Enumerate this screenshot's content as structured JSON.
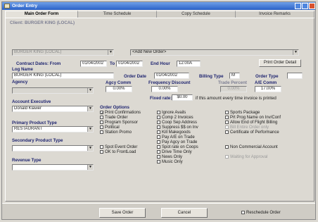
{
  "window": {
    "title": "Order Entry"
  },
  "tabs": [
    "Main Order Form",
    "Time Schedule",
    "Copy Schedule",
    "Invoice Remarks"
  ],
  "client_label": "Client: BURGER KING (LOCAL)",
  "advertiser_value": "BURGER KING (LOCAL)",
  "order_select_value": "<Add New Order>",
  "contract": {
    "label": "Contract Dates: From",
    "from": "01/04/2002",
    "to_label": "To",
    "to": "01/04/2002",
    "end_hour_label": "End Hour",
    "end_hour": "12:00A"
  },
  "print_detail_button": "Print Order Detail",
  "log_name": {
    "label": "Log Name",
    "value": "BURGER KING (LOCAL)"
  },
  "order_date": {
    "label": "Order Date",
    "value": "01/04/2002"
  },
  "billing_type": {
    "label": "Billing Type",
    "value": "M"
  },
  "order_type": {
    "label": "Order Type",
    "value": ""
  },
  "agency": {
    "label": "Agency",
    "value": ""
  },
  "agcy_comm": {
    "label": "Agcy Comm",
    "value": "0.00%"
  },
  "freq_discount": {
    "label": "Frequency Discount",
    "value": "0.00%"
  },
  "trade_percent": {
    "label": "Trade Percent",
    "value": "0.00%"
  },
  "ae_comm": {
    "label": "A/E Comm",
    "value": "17.00%"
  },
  "fixed_rate": {
    "label": "Fixed rate:",
    "value": "$0.00",
    "note": "if this amount every time invoice is printed"
  },
  "account_exec": {
    "label": "Account Executive",
    "value": "Donald Klawer"
  },
  "order_options_label": "Order Options",
  "primary_product": {
    "label": "Primary Product Type",
    "value": "RESTAURANT"
  },
  "secondary_product": {
    "label": "Secondary Product Type",
    "value": ""
  },
  "revenue_type": {
    "label": "Revenue Type",
    "value": ""
  },
  "options_col1": [
    "Print Confirmations",
    "Trade Order",
    "Program Sponsor",
    "Political",
    "Station Promo"
  ],
  "options_col1b": [
    "Spot Event Order",
    "OK to FrontLoad"
  ],
  "options_col2": [
    "Ignore Avails",
    "Comp 2 Invoices",
    "Coop Sep Address",
    "Suppress $$ on Inv",
    "Kill Makegoods",
    "Pay A/E on Trade",
    "Pay Agcy on Trade",
    "Spot rate on Coops",
    "Drive Time Only",
    "News Only",
    "Music Only"
  ],
  "options_col3": [
    "Sports Package",
    "Prt Prog Name on Inv/Conf",
    "Allow End of Flight Billing",
    "Bill Entire Order only",
    "Certificate of Performance"
  ],
  "option_noncommercial": "Non Commercial Account",
  "option_waiting": "Waiting for Approval",
  "footer": {
    "save": "Save Order",
    "cancel": "Cancel",
    "reschedule": "Reschedule Order"
  }
}
